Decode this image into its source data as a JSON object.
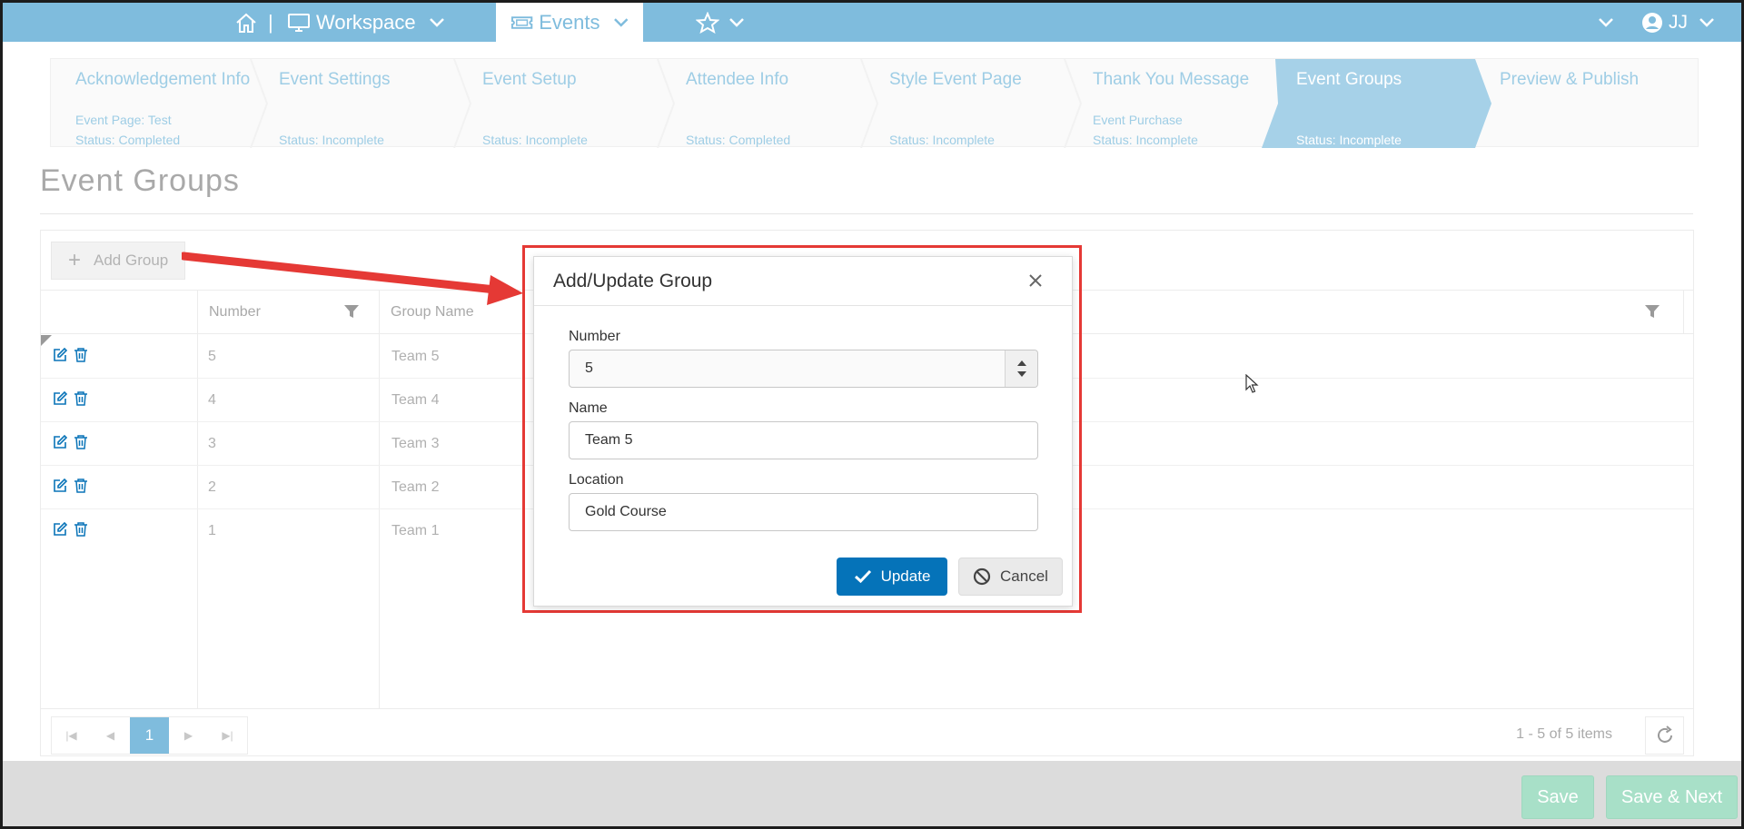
{
  "nav": {
    "workspace_label": "Workspace",
    "events_label": "Events",
    "separator": "|",
    "user_initials": "JJ"
  },
  "wizard": [
    {
      "title": "Acknowledgement Info",
      "sub1": "Event Page: Test",
      "sub2": "Status: Completed"
    },
    {
      "title": "Event Settings",
      "sub1": "",
      "sub2": "Status: Incomplete"
    },
    {
      "title": "Event Setup",
      "sub1": "",
      "sub2": "Status: Incomplete"
    },
    {
      "title": "Attendee Info",
      "sub1": "",
      "sub2": "Status: Completed"
    },
    {
      "title": "Style Event Page",
      "sub1": "",
      "sub2": "Status: Incomplete"
    },
    {
      "title": "Thank You Message",
      "sub1": "Event Purchase",
      "sub2": "Status: Incomplete"
    },
    {
      "title": "Event Groups",
      "sub1": "",
      "sub2": "Status: Incomplete"
    },
    {
      "title": "Preview & Publish",
      "sub1": "",
      "sub2": ""
    }
  ],
  "page": {
    "title": "Event Groups"
  },
  "grid": {
    "add_label": "Add Group",
    "columns": [
      "Number",
      "Group Name"
    ],
    "rows": [
      {
        "number": "5",
        "name": "Team 5"
      },
      {
        "number": "4",
        "name": "Team 4"
      },
      {
        "number": "3",
        "name": "Team 3"
      },
      {
        "number": "2",
        "name": "Team 2"
      },
      {
        "number": "1",
        "name": "Team 1"
      }
    ],
    "current_page": "1",
    "items_info": "1 - 5 of 5 items"
  },
  "dialog": {
    "title": "Add/Update Group",
    "number_label": "Number",
    "number_value": "5",
    "name_label": "Name",
    "name_value": "Team 5",
    "location_label": "Location",
    "location_value": "Gold Course",
    "update_label": "Update",
    "cancel_label": "Cancel"
  },
  "footer": {
    "save_label": "Save",
    "save_next_label": "Save & Next"
  },
  "colors": {
    "nav": "#7fbcdd",
    "primary": "#0573b9",
    "highlight": "#e53935",
    "footer_btn": "#a8e0c8"
  }
}
